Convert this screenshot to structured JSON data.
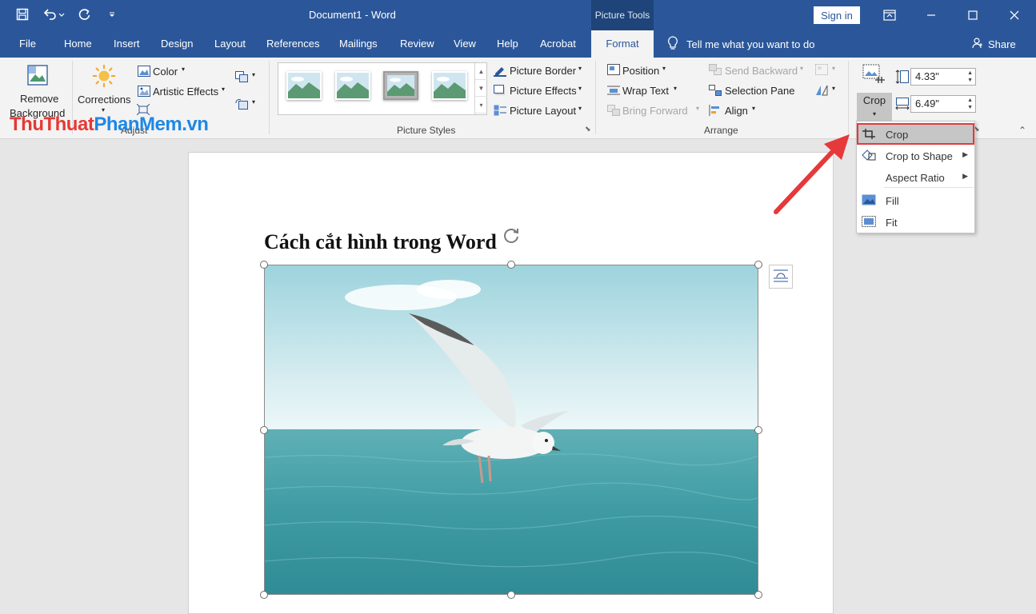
{
  "titlebar": {
    "doc_title": "Document1  -  Word",
    "contextual_tab": "Picture Tools",
    "sign_in": "Sign in"
  },
  "tabs": [
    {
      "label": "File"
    },
    {
      "label": "Home"
    },
    {
      "label": "Insert"
    },
    {
      "label": "Design"
    },
    {
      "label": "Layout"
    },
    {
      "label": "References"
    },
    {
      "label": "Mailings"
    },
    {
      "label": "Review"
    },
    {
      "label": "View"
    },
    {
      "label": "Help"
    },
    {
      "label": "Acrobat"
    },
    {
      "label": "Format"
    }
  ],
  "tell_me": "Tell me what you want to do",
  "share": "Share",
  "ribbon": {
    "adjust": {
      "remove_bg_line1": "Remove",
      "remove_bg_line2": "Background",
      "corrections": "Corrections",
      "color": "Color",
      "artistic_effects": "Artistic Effects",
      "group_label": "Adjust"
    },
    "picture_styles": {
      "picture_border": "Picture Border",
      "picture_effects": "Picture Effects",
      "picture_layout": "Picture Layout",
      "group_label": "Picture Styles"
    },
    "arrange": {
      "position": "Position",
      "wrap_text": "Wrap Text",
      "bring_forward": "Bring Forward",
      "send_backward": "Send Backward",
      "selection_pane": "Selection Pane",
      "align": "Align",
      "group_label": "Arrange"
    },
    "size": {
      "crop": "Crop",
      "height": "4.33\"",
      "width": "6.49\""
    }
  },
  "watermark": {
    "part1": "Thu",
    "part2": "Thuat",
    "part3": "Phan",
    "part4": "Mem",
    "part5": ".vn"
  },
  "document": {
    "heading": "Cách cắt hình trong Word"
  },
  "crop_menu": {
    "items": [
      {
        "label": "Crop",
        "icon": "crop-icon",
        "has_submenu": false
      },
      {
        "label": "Crop to Shape",
        "icon": "crop-to-shape-icon",
        "has_submenu": true
      },
      {
        "label": "Aspect Ratio",
        "icon": "",
        "has_submenu": true
      },
      {
        "label": "Fill",
        "icon": "fill-icon",
        "has_submenu": false
      },
      {
        "label": "Fit",
        "icon": "fit-icon",
        "has_submenu": false
      }
    ]
  },
  "colors": {
    "accent": "#2b579a",
    "highlight_outline": "#e5393b",
    "watermark_red": "#e53935",
    "watermark_blue": "#1e88e5"
  }
}
